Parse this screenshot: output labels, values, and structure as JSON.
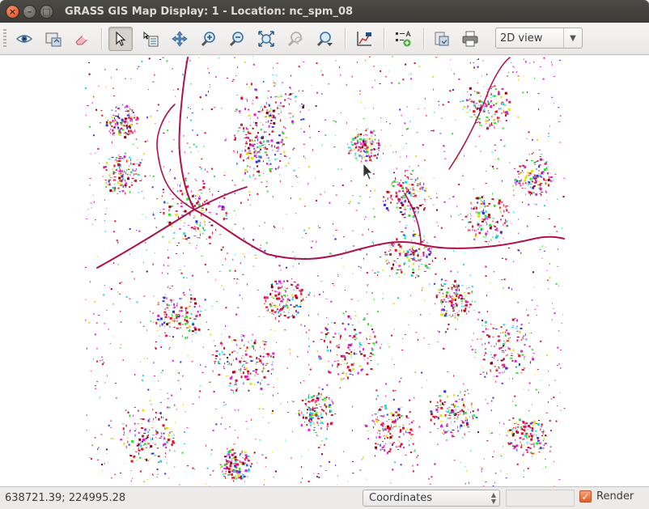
{
  "window": {
    "title": "GRASS GIS Map Display: 1  - Location: nc_spm_08",
    "close_glyph": "×",
    "min_glyph": "–",
    "max_glyph": "□"
  },
  "toolbar": {
    "buttons": [
      {
        "name": "display-map-button",
        "icon": "eye-icon"
      },
      {
        "name": "render-map-button",
        "icon": "render-icon"
      },
      {
        "name": "erase-display-button",
        "icon": "eraser-icon"
      },
      {
        "name": "pointer-tool-button",
        "icon": "pointer-icon",
        "active": true
      },
      {
        "name": "query-button",
        "icon": "query-icon"
      },
      {
        "name": "pan-button",
        "icon": "pan-icon"
      },
      {
        "name": "zoom-in-button",
        "icon": "zoom-in-icon"
      },
      {
        "name": "zoom-out-button",
        "icon": "zoom-out-icon"
      },
      {
        "name": "zoom-extent-button",
        "icon": "zoom-extent-icon"
      },
      {
        "name": "zoom-back-button",
        "icon": "zoom-back-icon"
      },
      {
        "name": "zoom-menu-button",
        "icon": "zoom-menu-icon"
      },
      {
        "name": "analyze-button",
        "icon": "chart-icon"
      },
      {
        "name": "decoration-button",
        "icon": "legend-icon"
      },
      {
        "name": "save-map-button",
        "icon": "save-icon"
      },
      {
        "name": "print-button",
        "icon": "printer-icon"
      }
    ],
    "view_mode": {
      "selected": "2D view"
    }
  },
  "statusbar": {
    "coordinates": "638721.39; 224995.28",
    "mode_select": "Coordinates",
    "render_checked": true,
    "render_label": "Render",
    "check_glyph": "✓"
  },
  "colors": {
    "raster_red": "#e0102a",
    "raster_magenta": "#e020d8",
    "raster_darkred": "#8b0010",
    "raster_green": "#30e030",
    "raster_blue": "#3030e0",
    "raster_cyan": "#20d8e0",
    "raster_yellow": "#e0e020"
  }
}
